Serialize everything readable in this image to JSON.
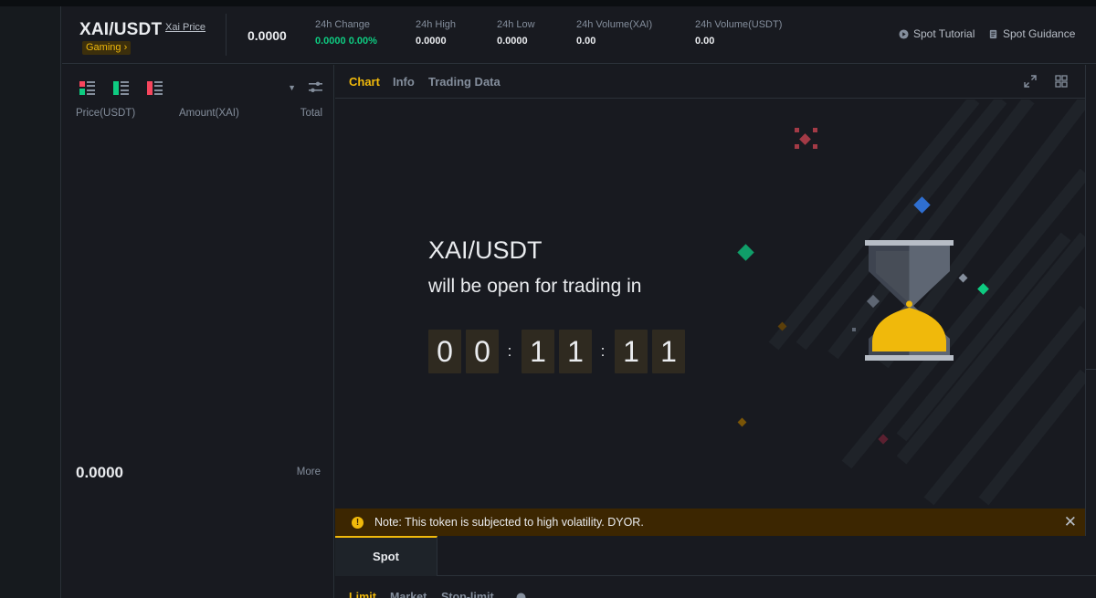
{
  "header": {
    "pair": "XAI/USDT",
    "price_link": "Xai Price",
    "tag": "Gaming ›",
    "last_price": "0.0000",
    "stats": [
      {
        "label": "24h Change",
        "value": "0.0000 0.00%",
        "color": "#0ecb81"
      },
      {
        "label": "24h High",
        "value": "0.0000"
      },
      {
        "label": "24h Low",
        "value": "0.0000"
      },
      {
        "label": "24h Volume(XAI)",
        "value": "0.00"
      },
      {
        "label": "24h Volume(USDT)",
        "value": "0.00"
      }
    ],
    "links": [
      {
        "label": "Spot Tutorial",
        "icon": "play-circle-icon"
      },
      {
        "label": "Spot Guidance",
        "icon": "document-icon"
      }
    ]
  },
  "orderbook": {
    "layout_icons": [
      "both-sides-layout-icon",
      "bids-only-layout-icon",
      "asks-only-layout-icon"
    ],
    "columns": [
      "Price(USDT)",
      "Amount(XAI)",
      "Total"
    ],
    "mid_price": "0.0000",
    "more_label": "More"
  },
  "chart": {
    "tabs": [
      {
        "label": "Chart",
        "active": true
      },
      {
        "label": "Info",
        "active": false
      },
      {
        "label": "Trading Data",
        "active": false
      }
    ],
    "countdown": {
      "title": "XAI/USDT",
      "subtitle": "will be open for trading in",
      "digits": [
        "0",
        "0",
        "1",
        "1",
        "1",
        "1"
      ]
    }
  },
  "note": {
    "text": "Note: This token is subjected to high volatility. DYOR."
  },
  "form": {
    "tab": "Spot",
    "order_types": [
      "Limit",
      "Market",
      "Stop-limit"
    ]
  },
  "colors": {
    "accent": "#f0b90b",
    "positive": "#0ecb81",
    "negative": "#f6465d",
    "background": "#181a20"
  }
}
